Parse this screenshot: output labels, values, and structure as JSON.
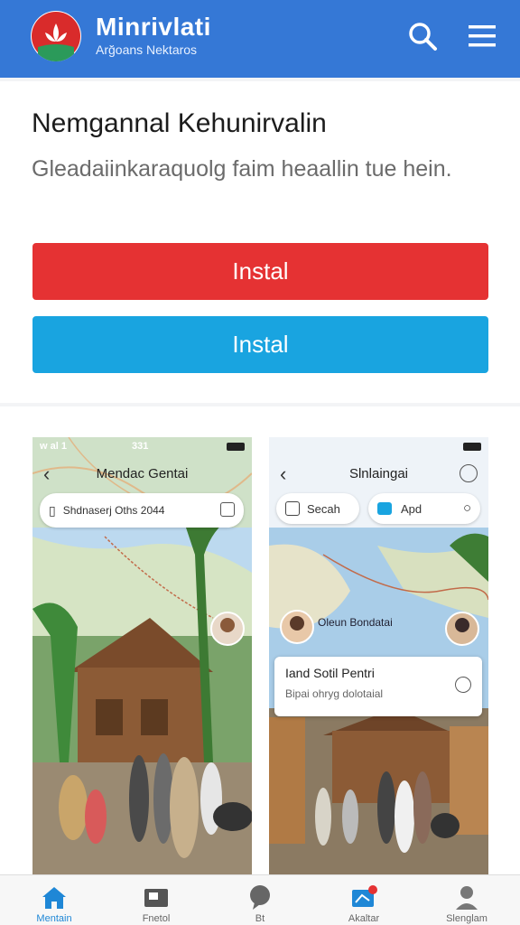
{
  "header": {
    "title": "Minrivlati",
    "subtitle": "Arğoans Nektaros",
    "search_icon": "search-icon",
    "menu_icon": "menu-icon",
    "bg_color": "#3578d6"
  },
  "hero": {
    "title": "Nemgannal Kehunirvalin",
    "description": "Gleadaiinkaraquolg faim heaallin tue hein.",
    "primary_button": "Instal",
    "secondary_button": "Instal",
    "primary_color": "#e53233",
    "secondary_color": "#19a4e0"
  },
  "screenshots": [
    {
      "status_left": "w al 1",
      "status_mid": "331",
      "title": "Mendac Gentai",
      "search_text": "Shdnaserj Oths 2044"
    },
    {
      "title": "Slnlaingai",
      "pill_left": "Secah",
      "pill_right": "Apd",
      "map_label": "Oleun Bondatai",
      "card_title": "Iand Sotil Pentri",
      "card_sub": "Bipai ohryg dolotaial"
    }
  ],
  "bottom_nav": [
    {
      "label": "Mentain",
      "icon": "home-icon",
      "active": true
    },
    {
      "label": "Fnetol",
      "icon": "wallet-icon",
      "active": false
    },
    {
      "label": "Bt",
      "icon": "chat-icon",
      "active": false
    },
    {
      "label": "Akaltar",
      "icon": "notification-icon",
      "active": false
    },
    {
      "label": "Slenglam",
      "icon": "profile-icon",
      "active": false
    }
  ]
}
